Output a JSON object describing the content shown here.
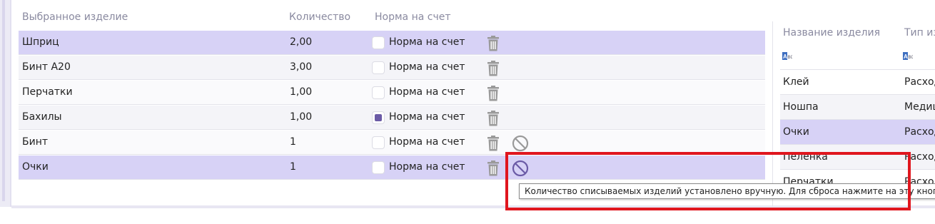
{
  "left_table": {
    "headers": {
      "name": "Выбранное изделие",
      "qty": "Количество",
      "norm": "Норма на счет"
    },
    "rows": [
      {
        "name": "Шприц",
        "qty": "2,00",
        "norm_label": "Норма на счет",
        "norm_checked": false,
        "selected": true,
        "manual": false
      },
      {
        "name": "Бинт А20",
        "qty": "3,00",
        "norm_label": "Норма на счет",
        "norm_checked": false,
        "selected": false,
        "manual": false
      },
      {
        "name": "Перчатки",
        "qty": "1,00",
        "norm_label": "Норма на счет",
        "norm_checked": false,
        "selected": false,
        "manual": false
      },
      {
        "name": "Бахилы",
        "qty": "1,00",
        "norm_label": "Норма на счет",
        "norm_checked": true,
        "selected": false,
        "manual": false
      },
      {
        "name": "Бинт",
        "qty": "1",
        "norm_label": "Норма на счет",
        "norm_checked": false,
        "selected": false,
        "manual": true
      },
      {
        "name": "Очки",
        "qty": "1",
        "norm_label": "Норма на счет",
        "norm_checked": false,
        "selected": true,
        "manual": true
      }
    ]
  },
  "right_table": {
    "headers": {
      "name": "Название изделия",
      "type": "Тип из"
    },
    "filter_icon_label": "ABC",
    "rows": [
      {
        "name": "Клей",
        "type": "Расход"
      },
      {
        "name": "Ношпа",
        "type": "Медиц"
      },
      {
        "name": "Очки",
        "type": "Расход",
        "selected": true
      },
      {
        "name": "Пеленка",
        "type": "Расход"
      },
      {
        "name": "Перчатки",
        "type": "Расход"
      }
    ]
  },
  "tooltip": {
    "text": "Количество списываемых изделий установлено вручную. Для сброса нажмите на эту кнопку."
  },
  "colors": {
    "selection": "#d7d2f6",
    "accent": "#6b5ba6",
    "annotation": "#e0161e"
  },
  "icons": {
    "delete": "trash-icon",
    "reset": "block-icon",
    "filter": "text-filter-icon"
  }
}
